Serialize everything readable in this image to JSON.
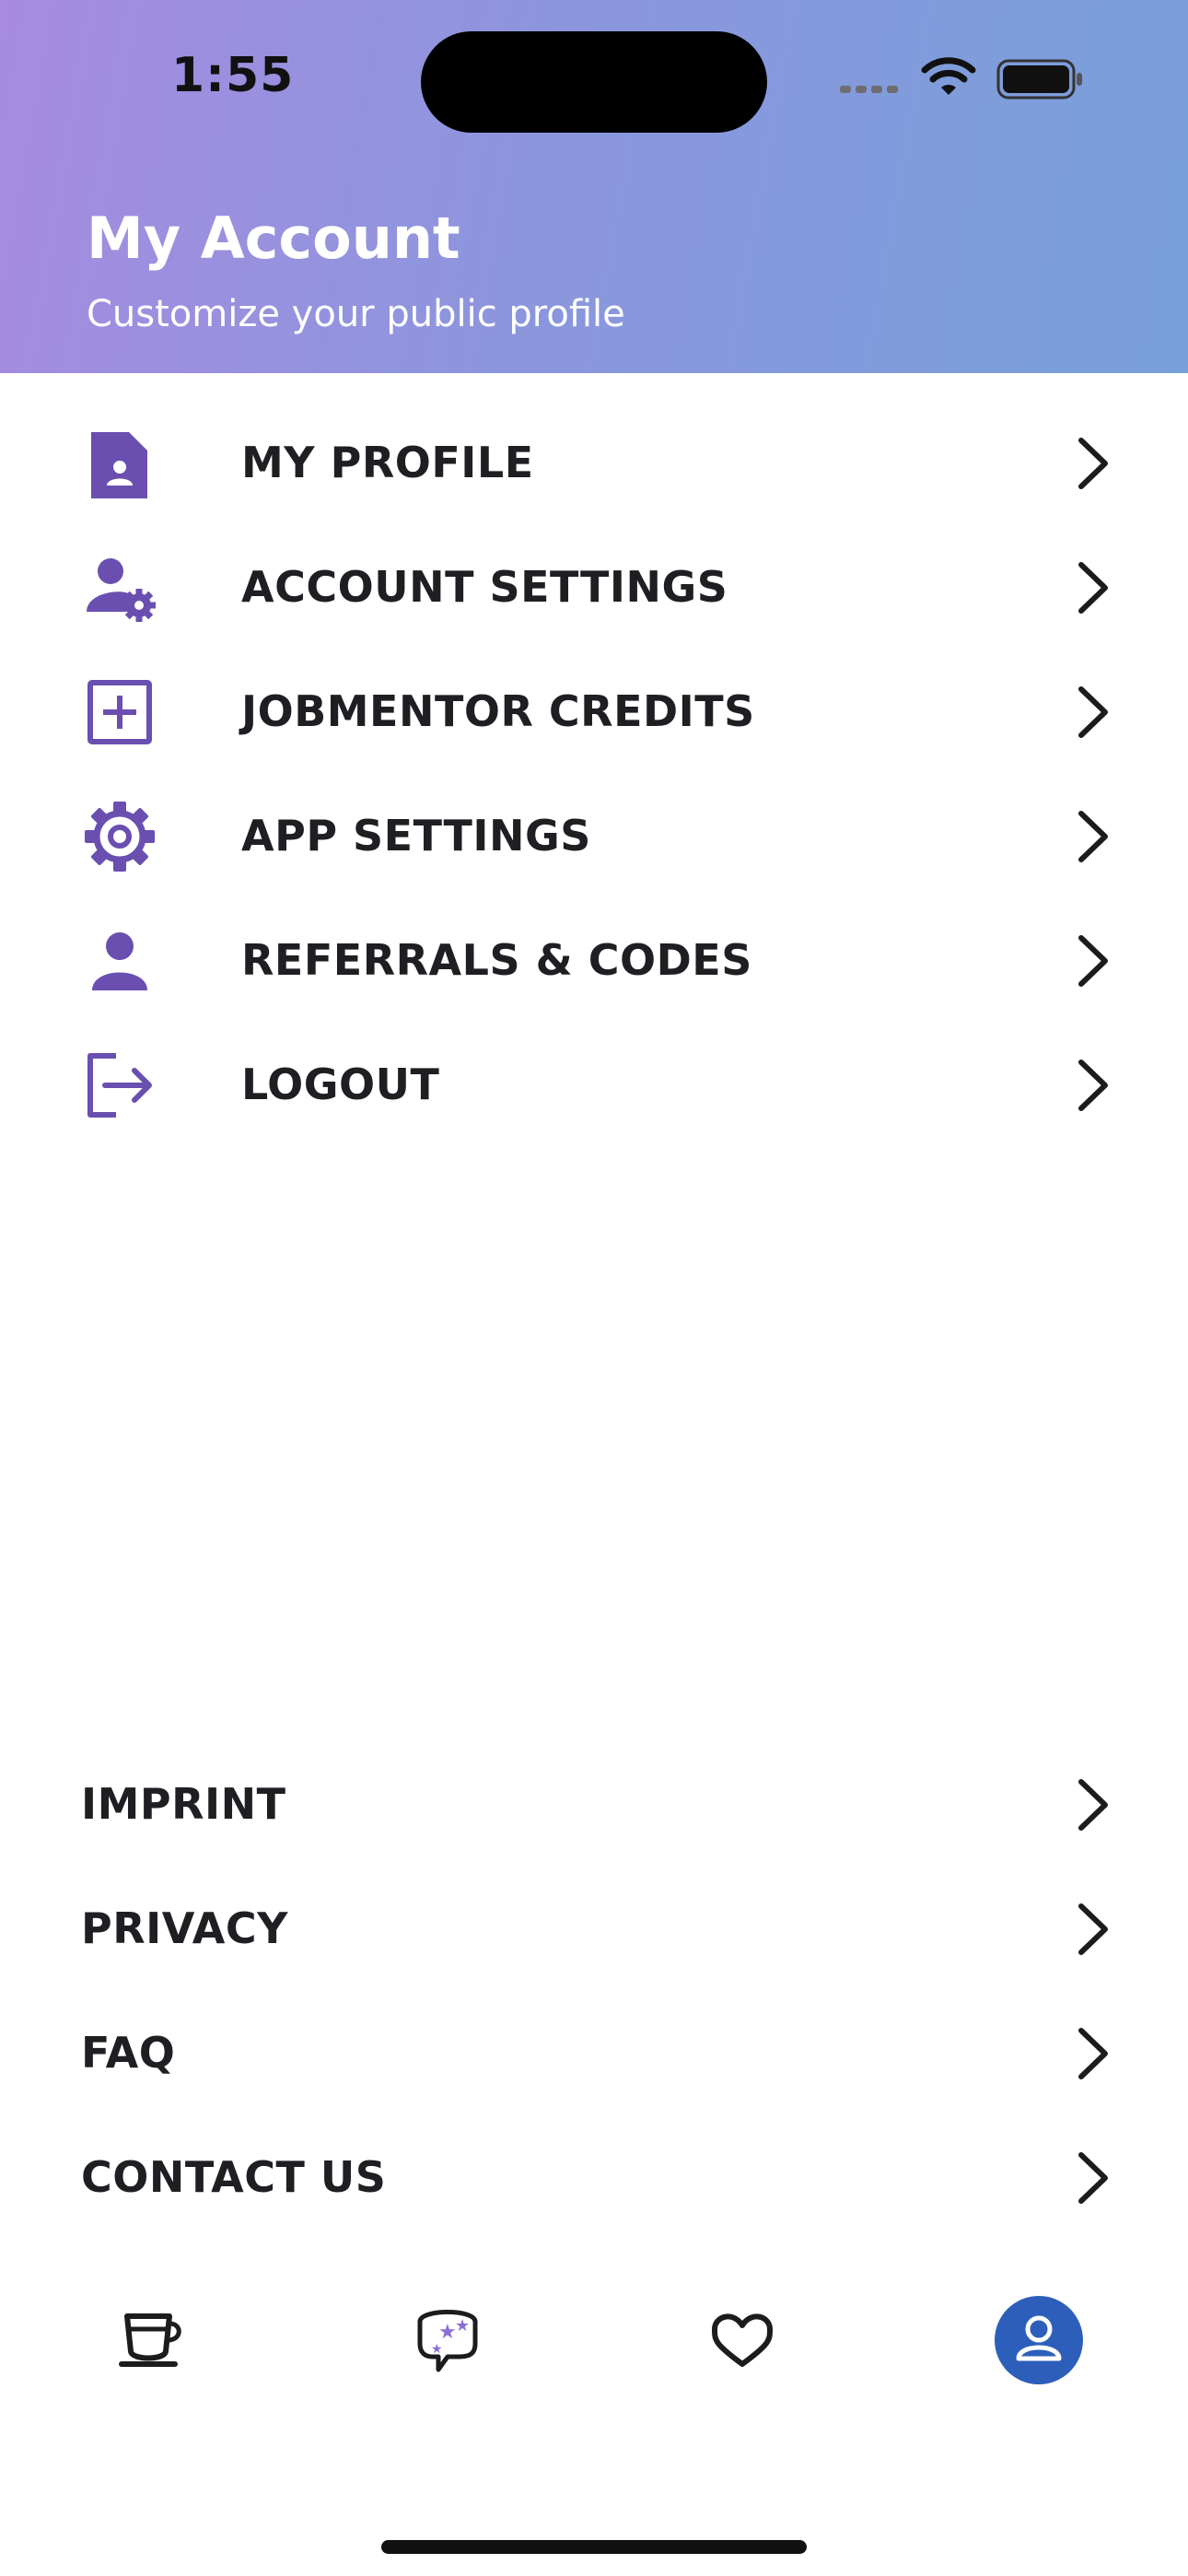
{
  "status_bar": {
    "time": "1:55"
  },
  "header": {
    "title": "My Account",
    "subtitle": "Customize your public profile"
  },
  "menu": {
    "items": [
      {
        "label": "MY PROFILE",
        "icon": "profile-document-icon"
      },
      {
        "label": "ACCOUNT SETTINGS",
        "icon": "user-cog-icon"
      },
      {
        "label": "JOBMENTOR CREDITS",
        "icon": "plus-square-icon"
      },
      {
        "label": "APP SETTINGS",
        "icon": "gear-icon"
      },
      {
        "label": "REFERRALS & CODES",
        "icon": "person-icon"
      },
      {
        "label": "LOGOUT",
        "icon": "logout-icon"
      }
    ]
  },
  "footer": {
    "items": [
      {
        "label": "IMPRINT"
      },
      {
        "label": "PRIVACY"
      },
      {
        "label": "FAQ"
      },
      {
        "label": "CONTACT US"
      }
    ]
  },
  "tabbar": {
    "tabs": [
      {
        "icon": "coffee-cup-icon",
        "active": false
      },
      {
        "icon": "chat-stars-icon",
        "active": false
      },
      {
        "icon": "heart-icon",
        "active": false
      },
      {
        "icon": "account-icon",
        "active": true
      }
    ]
  },
  "colors": {
    "header_gradient_start": "#a68be0",
    "header_gradient_end": "#78a0da",
    "icon_accent": "#6a4fb0",
    "active_tab": "#2d5fba",
    "text": "#1f1f23"
  }
}
